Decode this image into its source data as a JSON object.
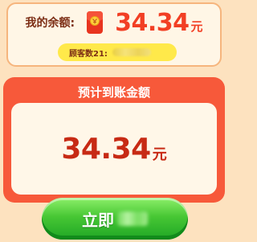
{
  "balance": {
    "label": "我的余额:",
    "amount": "34.34",
    "unit": "元",
    "icon": "wallet-icon"
  },
  "customers": {
    "text": "顾客数21:"
  },
  "estimate": {
    "title": "预计到账金额",
    "amount": "34.34",
    "unit": "元"
  },
  "action": {
    "label": "立即"
  },
  "colors": {
    "accent_red": "#f7593a",
    "amount_red": "#c72a14",
    "button_green": "#47c734",
    "pill_yellow": "#ffe94a"
  }
}
